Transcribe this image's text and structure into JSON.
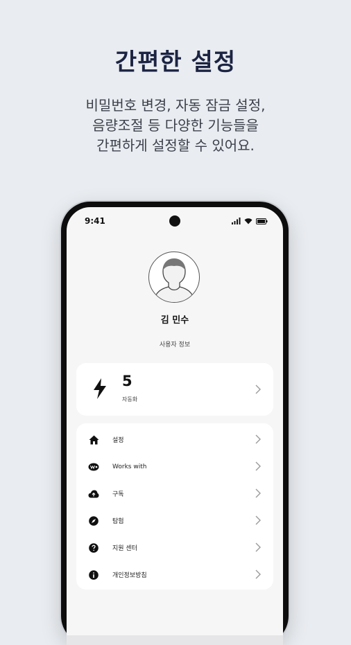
{
  "headline": "간편한 설정",
  "subtext": {
    "line1": "비밀번호 변경, 자동 잠금 설정,",
    "line2": "음량조절 등 다양한 기능들을",
    "line3": "간편하게 설정할 수 있어요."
  },
  "status_bar": {
    "time": "9:41",
    "icons": [
      "signal-icon",
      "wifi-icon",
      "battery-icon"
    ]
  },
  "profile": {
    "name": "김 민수",
    "info_link": "사용자 정보"
  },
  "automation_card": {
    "count": "5",
    "label": "자동화",
    "icon": "bolt-icon"
  },
  "menu": {
    "items": [
      {
        "label": "설정",
        "icon": "home-icon"
      },
      {
        "label": "Works with",
        "icon": "works-with-icon"
      },
      {
        "label": "구독",
        "icon": "cloud-upload-icon"
      },
      {
        "label": "탐험",
        "icon": "compass-icon"
      },
      {
        "label": "지원 센터",
        "icon": "help-icon"
      },
      {
        "label": "개인정보방침",
        "icon": "info-icon"
      }
    ]
  },
  "colors": {
    "background": "#e9ecf0",
    "headline": "#1c2443",
    "card": "#ffffff"
  }
}
